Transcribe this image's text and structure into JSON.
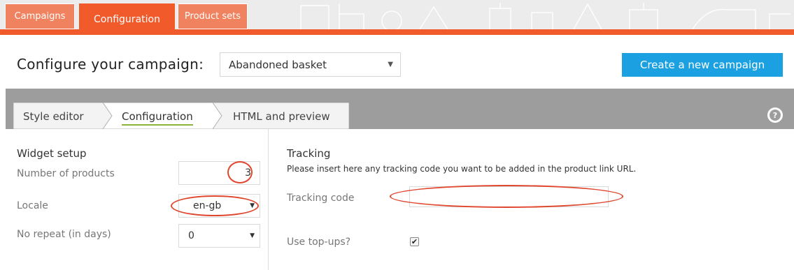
{
  "nav": {
    "tabs": [
      {
        "label": "Campaigns",
        "active": false
      },
      {
        "label": "Configuration",
        "active": true
      },
      {
        "label": "Product sets",
        "active": false
      }
    ]
  },
  "header": {
    "title": "Configure your campaign:",
    "campaign_select": {
      "value": "Abandoned basket",
      "icon": "chevron-down-icon"
    },
    "create_button_label": "Create a new campaign"
  },
  "subtabs": [
    {
      "label": "Style editor",
      "active": false
    },
    {
      "label": "Configuration",
      "active": true
    },
    {
      "label": "HTML and preview",
      "active": false
    }
  ],
  "help_icon": {
    "icon": "help-icon",
    "glyph": "?"
  },
  "widget_setup": {
    "title": "Widget setup",
    "number_of_products": {
      "label": "Number of products",
      "value": "3"
    },
    "locale": {
      "label": "Locale",
      "value": "en-gb"
    },
    "no_repeat": {
      "label": "No repeat (in days)",
      "value": "0"
    }
  },
  "tracking": {
    "title": "Tracking",
    "description": "Please insert here any tracking code you want to be added in the product link URL.",
    "tracking_code": {
      "label": "Tracking code",
      "value": ""
    },
    "use_topups": {
      "label": "Use top-ups?",
      "checked": true,
      "mark": "✔"
    }
  },
  "colors": {
    "accent_orange": "#f15a2b",
    "tab_orange_light": "#f0825f",
    "button_blue": "#1ba1e2",
    "band_grey": "#9d9d9d",
    "annotation_red": "#e0462d",
    "active_underline": "#8bb43a"
  }
}
